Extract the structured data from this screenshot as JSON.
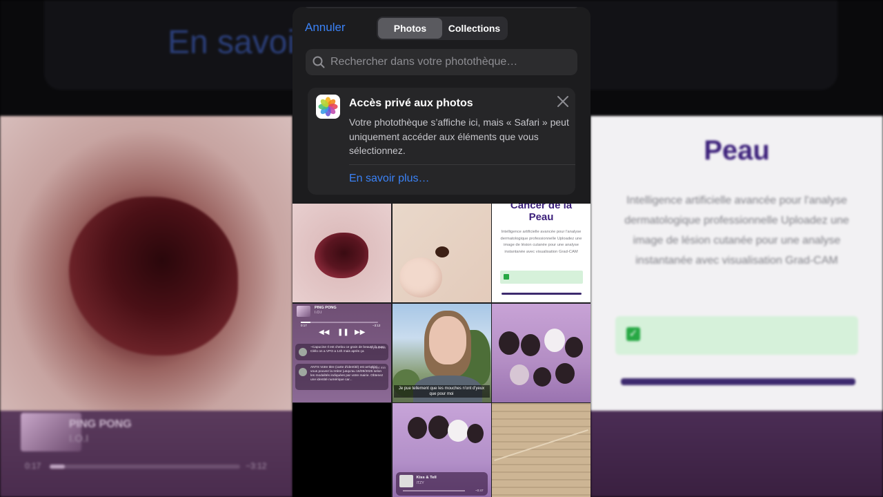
{
  "background": {
    "top_text": "En savoir",
    "music_title": "PING PONG",
    "music_artist": "I.O.I",
    "music_time_elapsed": "0:17",
    "music_time_remaining": "−3:12",
    "right_title": "Peau",
    "right_subtitle": "Intelligence artificielle avancée pour l'analyse dermatologique professionnelle Uploadez une image de lésion cutanée pour une analyse instantanée avec visualisation Grad-CAM"
  },
  "header": {
    "cancel_label": "Annuler",
    "tabs": [
      {
        "label": "Photos",
        "active": true
      },
      {
        "label": "Collections",
        "active": false
      }
    ]
  },
  "search": {
    "placeholder": "Rechercher dans votre photothèque…"
  },
  "banner": {
    "title": "Accès privé aux photos",
    "body": "Votre photothèque s’affiche ici, mais « Safari » peut uniquement accéder aux éléments que vous sélectionnez.",
    "link": "En savoir plus…"
  },
  "grid": {
    "web_title_1": "Cancer de la",
    "web_title_2": "Peau",
    "web_sub": "Intelligence artificielle avancée pour l'analyse dermatologique professionnelle Uploadez une image de lésion cutanée pour une analyse instantanée avec visualisation Grad-CAM",
    "music_title": "PING PONG",
    "music_artist": "I.O.I",
    "music_elapsed": "0:17",
    "music_remaining": "−3:12",
    "notif1_text": "~Capucine Il est chelou ce grain de beauté là avec Clélo on a VPO a 14h mais après ça",
    "notif1_time": "il y a 1 min",
    "notif2_text": "ANTS Votre titre (carte d'identité) est arrivé(e), vous pouvez la retirer jusqu'au 16/09/2025 selon les modalités indiquées par votre mairie. Obtenez une identité numérique car...",
    "notif2_time": "il y a 4 min",
    "selfie_caption": "Je pue tellement que les mouches n'ont d'yeux que pour moi",
    "mini_title": "Kiss & Tell",
    "mini_artist": "ITZY",
    "mini_elapsed": "1:00",
    "mini_remaining": "−0:47"
  },
  "colors": {
    "accent": "#3b82f6",
    "sheet": "#1c1c1e",
    "field": "#2c2c2e"
  }
}
